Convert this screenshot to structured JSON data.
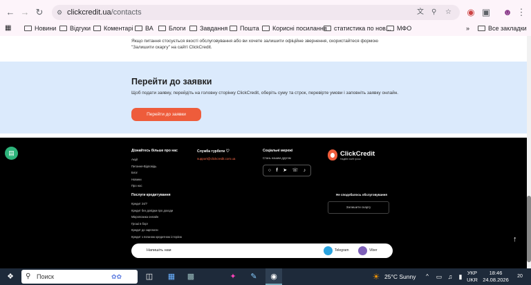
{
  "browser": {
    "url_host": "clickcredit.ua",
    "url_path": "/contacts",
    "bookmarks": [
      "Новини",
      "Відгуки",
      "Коментарі",
      "ВА",
      "Блоги",
      "Завдання",
      "Пошта",
      "Корисні посилання",
      "статистика по нов...",
      "МФО"
    ],
    "all_bookmarks": "Все закладки"
  },
  "page": {
    "top_note": "Якщо питання стосується якості обслуговування або ви хочете залишити офіційне звернення, скористайтеся формою \"Залишити скаргу\" на сайті ClickCredit.",
    "cta": {
      "title": "Перейти до заявки",
      "text": "Щоб подати заявку, перейдіть на головну сторінку ClickCredit, оберіть суму та строк, перевірте умови і заповніть заявку онлайн.",
      "button": "Перейти до заявки"
    },
    "footer": {
      "learn_title": "Дізнайтесь більше про нас",
      "learn_links": [
        "Акції",
        "Питання-Відповідь",
        "Блог",
        "Новини",
        "Про нас"
      ],
      "support_title": "Служба турботи",
      "support_email": "support@clickcredit.com.ua",
      "social_title": "Соціальні мережі",
      "social_sub": "Стань нашим другом",
      "social_icons": [
        "instagram-icon",
        "facebook-icon",
        "telegram-icon",
        "viber-icon",
        "tiktok-icon"
      ],
      "logo_name": "ClickCredit",
      "logo_tag": "Надійні swift гроші",
      "services_title": "Послуги кредитування",
      "services_links": [
        "Кредит 24/7",
        "Кредит без довідки про доходи",
        "Мікропозика онлайн",
        "Гроші в борг",
        "Кредит до зарплати",
        "Кредит з поганою кредитною історією"
      ],
      "complaint_title": "Не сподобалось обслуговування",
      "complaint_button": "Залишити скаргу",
      "write_us": "Напишіть нам",
      "telegram": "Telegram",
      "viber": "Viber"
    }
  },
  "taskbar": {
    "search": "Поиск",
    "weather": "25°C  Sunny",
    "lang1": "УКР",
    "lang2": "UKR",
    "time": "18:46",
    "date": "24.08.2026",
    "badge": "20"
  }
}
